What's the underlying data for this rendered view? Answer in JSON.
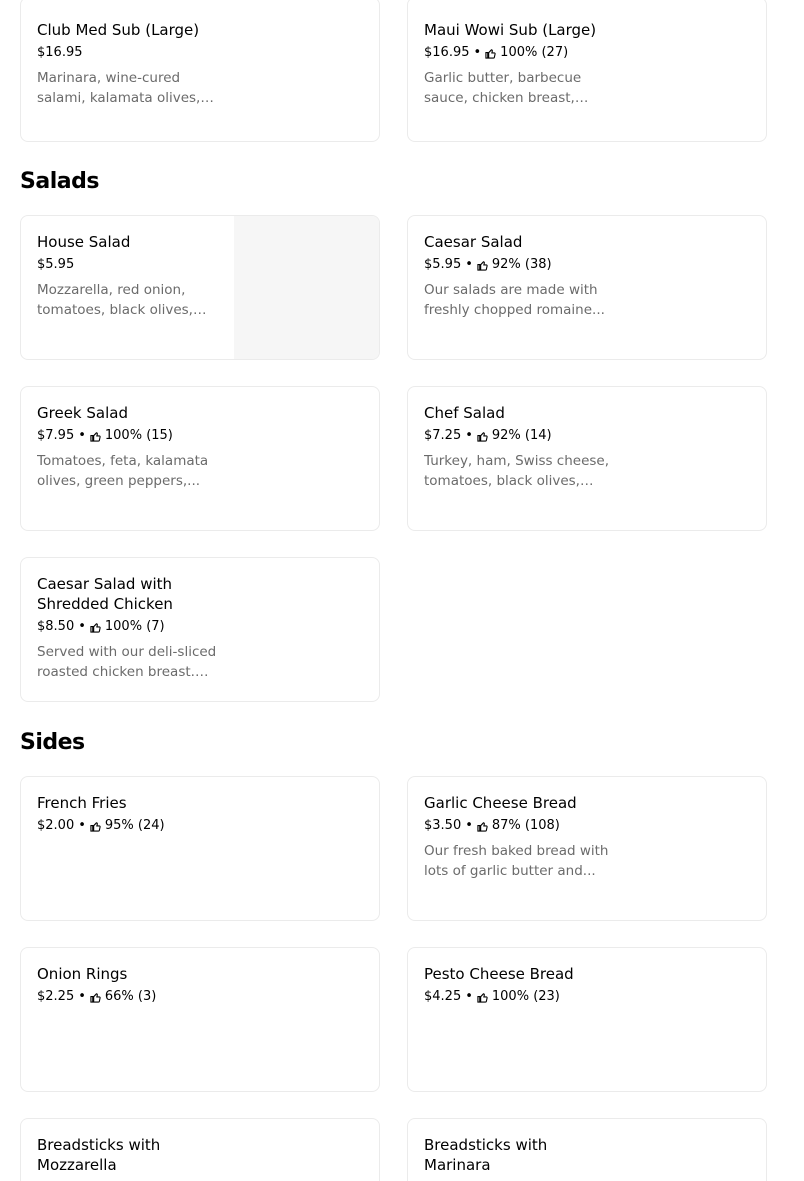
{
  "sections": {
    "salads": "Salads",
    "sides": "Sides"
  },
  "items": {
    "club_med": {
      "name": "Club Med Sub (Large)",
      "price": "$16.95",
      "desc": "Marinara, wine-cured salami, kalamata olives, feta cheese..."
    },
    "maui_wowi": {
      "name": "Maui Wowi Sub (Large)",
      "price": "$16.95",
      "rating": "100% (27)",
      "desc": "Garlic butter, barbecue sauce, chicken breast, ham..."
    },
    "house_salad": {
      "name": "House Salad",
      "price": "$5.95",
      "desc": "Mozzarella, red onion, tomatoes, black olives, and..."
    },
    "caesar_salad": {
      "name": "Caesar Salad",
      "price": "$5.95",
      "rating": "92% (38)",
      "desc": "Our salads are made with freshly chopped romaine..."
    },
    "greek_salad": {
      "name": "Greek Salad",
      "price": "$7.95",
      "rating": "100% (15)",
      "desc": "Tomatoes, feta, kalamata olives, green peppers,..."
    },
    "chef_salad": {
      "name": "Chef Salad",
      "price": "$7.25",
      "rating": "92% (14)",
      "desc": "Turkey, ham, Swiss cheese, tomatoes, black olives, red..."
    },
    "caesar_chicken": {
      "name": "Caesar Salad with Shredded Chicken",
      "price": "$8.50",
      "rating": "100% (7)",
      "desc": "Served with our deli-sliced roasted chicken breast. Ou..."
    },
    "french_fries": {
      "name": "French Fries",
      "price": "$2.00",
      "rating": "95% (24)"
    },
    "garlic_bread": {
      "name": "Garlic Cheese Bread",
      "price": "$3.50",
      "rating": "87% (108)",
      "desc": "Our fresh baked bread with lots of garlic butter and..."
    },
    "onion_rings": {
      "name": "Onion Rings",
      "price": "$2.25",
      "rating": "66% (3)"
    },
    "pesto_bread": {
      "name": "Pesto Cheese Bread",
      "price": "$4.25",
      "rating": "100% (23)"
    },
    "breadsticks_mozz": {
      "name": "Breadsticks with Mozzarella"
    },
    "breadsticks_marinara": {
      "name": "Breadsticks with Marinara"
    }
  },
  "separator": "•"
}
